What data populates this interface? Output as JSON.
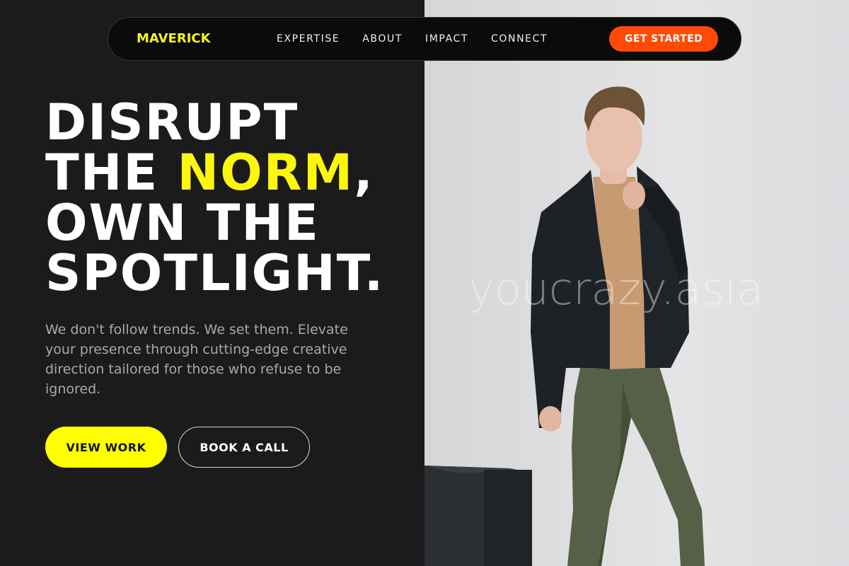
{
  "brand": {
    "name": "MAVERICK",
    "accent": "#f7f21f"
  },
  "nav": {
    "links": [
      "EXPERTISE",
      "ABOUT",
      "IMPACT",
      "CONNECT"
    ],
    "cta_label": "GET STARTED",
    "cta_color": "#ff4a06"
  },
  "hero": {
    "line1": "DISRUPT",
    "line2_pre": "THE ",
    "line2_highlight": "NORM",
    "line2_post": ",",
    "line3": "OWN THE",
    "line4": "SPOTLIGHT.",
    "highlight_color": "#fcf60d",
    "subtext": "We don't follow trends. We set them. Elevate your presence through cutting-edge creative direction tailored for those who refuse to be ignored.",
    "primary_button": "VIEW WORK",
    "secondary_button": "BOOK A CALL"
  },
  "image": {
    "watermark": "youcrazy.asia",
    "description_icon": "model-photo"
  }
}
